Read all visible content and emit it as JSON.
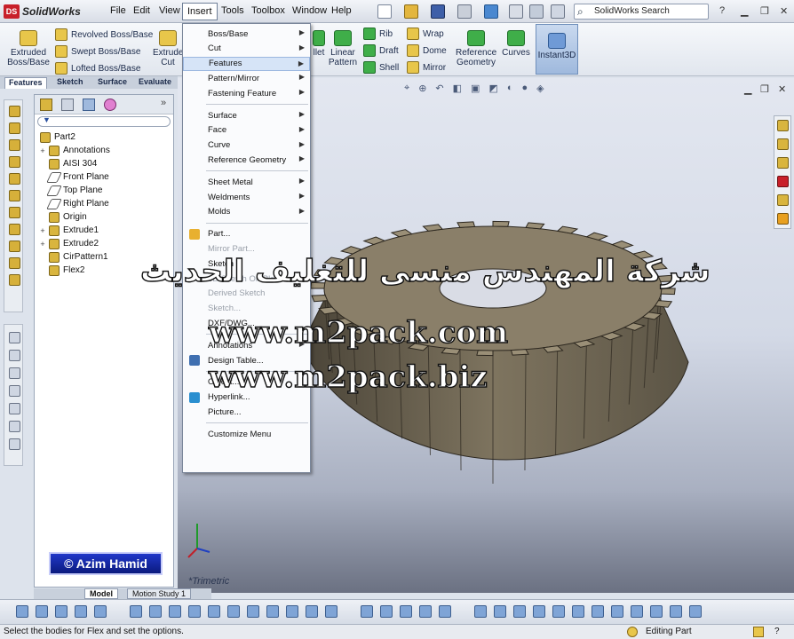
{
  "app": {
    "logo_brand": "DS",
    "name": "SolidWorks"
  },
  "menubar": {
    "items": [
      "File",
      "Edit",
      "View",
      "Insert",
      "Tools",
      "Toolbox",
      "Window",
      "Help"
    ],
    "search_placeholder": "SolidWorks Search"
  },
  "command_manager": {
    "extruded_boss": "Extruded\nBoss/Base",
    "revolved_boss": "Revolved Boss/Base",
    "swept_boss": "Swept Boss/Base",
    "lofted_boss": "Lofted Boss/Base",
    "extruded_cut": "Extrude\nCut",
    "fillet": "llet",
    "linear_pattern": "Linear\nPattern",
    "rib": "Rib",
    "draft": "Draft",
    "shell": "Shell",
    "wrap": "Wrap",
    "dome": "Dome",
    "mirror": "Mirror",
    "reference_geometry": "Reference\nGeometry",
    "curves": "Curves",
    "instant3d": "Instant3D"
  },
  "tabs": [
    "Features",
    "Sketch",
    "Surface",
    "Evaluate"
  ],
  "tree": {
    "root": "Part2",
    "nodes": [
      {
        "label": "Annotations",
        "exp": "+"
      },
      {
        "label": "AISI 304",
        "exp": ""
      },
      {
        "label": "Front Plane",
        "exp": ""
      },
      {
        "label": "Top Plane",
        "exp": ""
      },
      {
        "label": "Right Plane",
        "exp": ""
      },
      {
        "label": "Origin",
        "exp": ""
      },
      {
        "label": "Extrude1",
        "exp": "+"
      },
      {
        "label": "Extrude2",
        "exp": "+"
      },
      {
        "label": "CirPattern1",
        "exp": ""
      },
      {
        "label": "Flex2",
        "exp": ""
      }
    ]
  },
  "credit": "© Azim Hamid",
  "bottom_tabs": [
    "Model",
    "Motion Study 1"
  ],
  "viewport": {
    "view_label": "*Trimetric"
  },
  "dropdown": {
    "items": [
      {
        "label": "Boss/Base",
        "sub": true,
        "dis": false
      },
      {
        "label": "Cut",
        "sub": true,
        "dis": false
      },
      {
        "label": "Features",
        "sub": true,
        "dis": false,
        "hl": true
      },
      {
        "label": "Pattern/Mirror",
        "sub": true,
        "dis": false
      },
      {
        "label": "Fastening Feature",
        "sub": true,
        "dis": false
      },
      {
        "label": "Surface",
        "sub": true,
        "dis": false
      },
      {
        "label": "Face",
        "sub": true,
        "dis": false
      },
      {
        "label": "Curve",
        "sub": true,
        "dis": false
      },
      {
        "label": "Reference Geometry",
        "sub": true,
        "dis": false
      },
      {
        "label": "Sheet Metal",
        "sub": true,
        "dis": false
      },
      {
        "label": "Weldments",
        "sub": true,
        "dis": false
      },
      {
        "label": "Molds",
        "sub": true,
        "dis": false
      },
      {
        "label": "Part...",
        "sub": false,
        "dis": false
      },
      {
        "label": "Mirror Part...",
        "sub": false,
        "dis": true
      },
      {
        "label": "Sketch",
        "sub": false,
        "dis": false
      },
      {
        "label": "3D Sketch On Plane",
        "sub": false,
        "dis": true
      },
      {
        "label": "Derived Sketch",
        "sub": false,
        "dis": true
      },
      {
        "label": "Sketch...",
        "sub": false,
        "dis": true
      },
      {
        "label": "DXF/DWG...",
        "sub": false,
        "dis": false
      },
      {
        "label": "Annotations",
        "sub": true,
        "dis": false
      },
      {
        "label": "Design Table...",
        "sub": false,
        "dis": false
      },
      {
        "label": "Object...",
        "sub": false,
        "dis": false
      },
      {
        "label": "Hyperlink...",
        "sub": false,
        "dis": false
      },
      {
        "label": "Picture...",
        "sub": false,
        "dis": false
      },
      {
        "label": "Customize Menu",
        "sub": false,
        "dis": false
      }
    ]
  },
  "watermark": {
    "arabic": "شركة المهندس منسى للتغليف الحديث",
    "url1": "www.m2pack.com",
    "url2": "www.m2pack.biz"
  },
  "status": {
    "message": "Select the bodies for Flex and set the options.",
    "mode": "Editing Part"
  },
  "colors": {
    "gear": "#6f6656",
    "accent": "#3f6fb0"
  }
}
